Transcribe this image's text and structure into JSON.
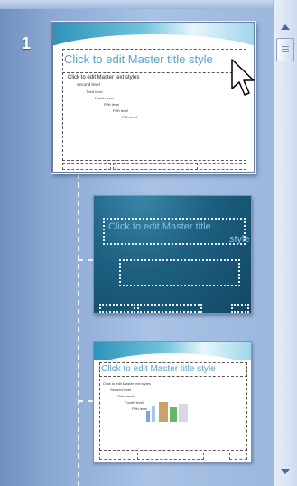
{
  "slide_pane": {
    "slide_number": "1",
    "master_title": "Click to edit Master title style",
    "master_text_lines": [
      "Click to edit Master text styles",
      "Second level",
      "Third level",
      "Fourth level",
      "Fifth level"
    ],
    "layout2_title_line1": "Click to edit Master title",
    "layout2_title_line2": "style"
  },
  "scrollbar": {
    "up_icon": "scroll-up-arrow",
    "down_icon": "scroll-down-arrow"
  },
  "colors": {
    "pane_gradient_start": "#6f8fbd",
    "pane_gradient_end": "#9db6dc",
    "title_text": "#5aa0c8",
    "dark_layout_bg": "#1d5f80"
  }
}
